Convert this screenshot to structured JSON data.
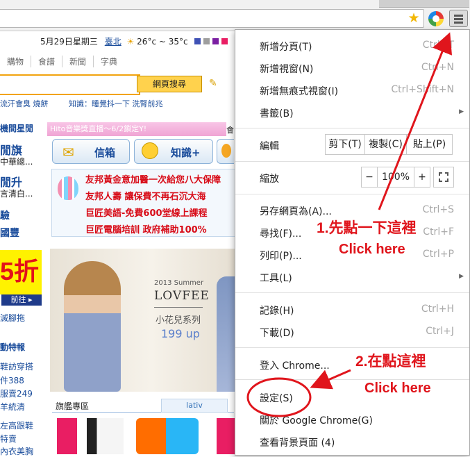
{
  "browser": {
    "menu_icon": "hamburger-menu-icon",
    "star_icon": "bookmark-star-icon",
    "extension_icon": "chrome-extension-icon"
  },
  "page": {
    "date": "5月29日星期三",
    "city": "臺北",
    "weather": "26°c ~ 35°c",
    "nav": [
      "購物",
      "食譜",
      "新聞",
      "字典"
    ],
    "search_button": "網頁搜尋",
    "hot_left": "流汗會臭",
    "hot_left2": "燒餅",
    "knowledge": "知識：睡覺抖一下 洗腎前兆",
    "left_items": [
      "機間星閒",
      "閒旗",
      "中華總...",
      "閒升",
      "言清白...",
      "驗",
      "國豐"
    ],
    "discount": "5折",
    "discount_go": "前往",
    "left_bottom": [
      "滅腳拖",
      "動特報",
      "鞋訪穿搭",
      "件388",
      "服賣249",
      "羊統清",
      "左高跟鞋",
      "特賣",
      "內衣美胸"
    ],
    "hito_banner": "Hito音樂獎直播～6/2鎖定Y!",
    "hito_side": "會",
    "mail_button": "信箱",
    "knowledge_button": "知識+",
    "ads": [
      "友邦黃金意加醫一次給您八大保障",
      "友邦人壽 讓保費不再石沉大海",
      "巨匠美語-免費600堂線上課程",
      "巨匠電腦培訓 政府補助100%"
    ],
    "banner_year": "2013 Summer",
    "banner_brand": "LOVFEE",
    "banner_series": "小花兒系列",
    "banner_price": "199 up",
    "flagship_title": "旗艦專區",
    "flagship_tab": "lativ"
  },
  "menu": {
    "new_tab": {
      "label": "新增分頁(T)",
      "shortcut": "Ctrl+T"
    },
    "new_window": {
      "label": "新增視窗(N)",
      "shortcut": "Ctrl+N"
    },
    "new_incognito": {
      "label": "新增無痕式視窗(I)",
      "shortcut": "Ctrl+Shift+N"
    },
    "bookmarks": {
      "label": "書籤(B)"
    },
    "edit": {
      "label": "編輯",
      "cut": "剪下(T)",
      "copy": "複製(C)",
      "paste": "貼上(P)"
    },
    "zoom": {
      "label": "縮放",
      "minus": "−",
      "value": "100%",
      "plus": "+",
      "fullscreen_icon": "fullscreen-icon"
    },
    "save_as": {
      "label": "另存網頁為(A)...",
      "shortcut": "Ctrl+S"
    },
    "find": {
      "label": "尋找(F)...",
      "shortcut": "Ctrl+F"
    },
    "print": {
      "label": "列印(P)...",
      "shortcut": "Ctrl+P"
    },
    "tools": {
      "label": "工具(L)"
    },
    "history": {
      "label": "記錄(H)",
      "shortcut": "Ctrl+H"
    },
    "downloads": {
      "label": "下載(D)",
      "shortcut": "Ctrl+J"
    },
    "signin": {
      "label": "登入 Chrome..."
    },
    "settings": {
      "label": "設定(S)"
    },
    "about": {
      "label": "關於 Google Chrome(G)"
    },
    "background": {
      "label": "查看背景頁面 (4)"
    }
  },
  "annotations": {
    "step1": "1.先點一下這裡",
    "step1_en": "Click here",
    "step2": "2.在點這裡",
    "step2_en": "Click here"
  },
  "colors": {
    "annotation": "#e0151c",
    "menu_border": "#a8a8a8",
    "link": "#1a4c9b"
  }
}
